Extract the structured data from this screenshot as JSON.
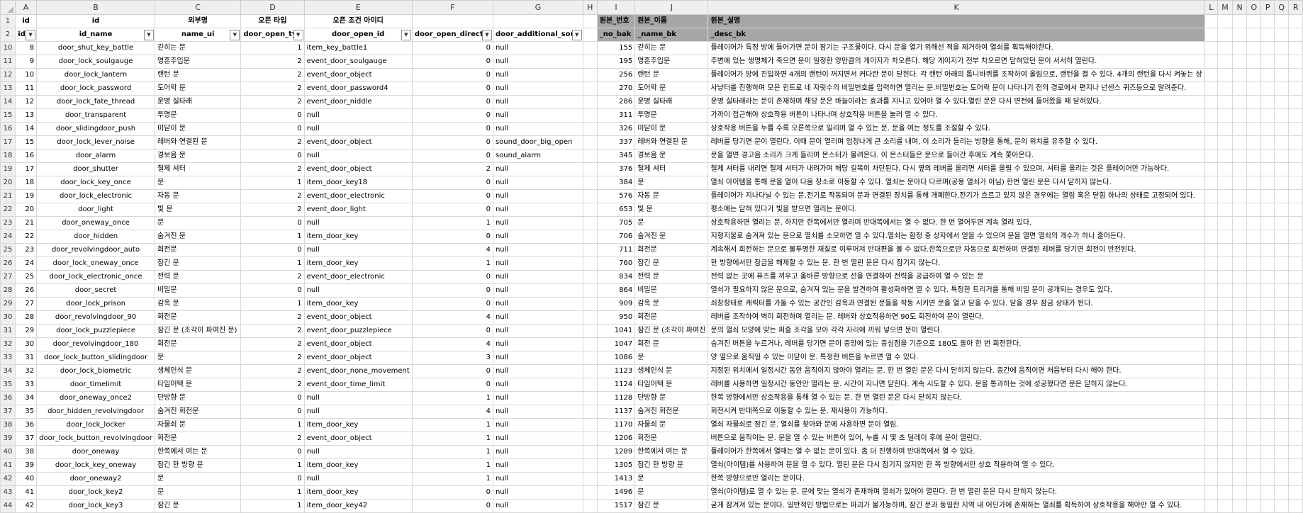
{
  "columns": [
    "A",
    "B",
    "C",
    "D",
    "E",
    "F",
    "G",
    "H",
    "I",
    "J",
    "K",
    "L",
    "M",
    "N",
    "O",
    "P",
    "Q",
    "R"
  ],
  "header1": [
    "id",
    "id",
    "외부명",
    "오픈 타입",
    "오픈 조건 아이디",
    "",
    "",
    "",
    "원본_번호",
    "원본_이름",
    "원본_설명",
    "",
    "",
    "",
    "",
    "",
    "",
    ""
  ],
  "header2": [
    "id_n",
    "id_name",
    "name_ui",
    "door_open_typ",
    "door_open_id",
    "door_open_directio",
    "door_additional_soun",
    "",
    "_no_bak",
    "_name_bk",
    "_desc_bk",
    "",
    "",
    "",
    "",
    "",
    "",
    ""
  ],
  "rows": [
    {
      "n": "10",
      "c": [
        "8",
        "door_shut_key_battle",
        "갇히는 문",
        "1",
        "item_key_battle1",
        "0",
        "null",
        "",
        "155",
        "갇히는 문",
        "플레이어가 특정 방에 들어가면 문이 잠기는 구조물이다. 다시 문을 열기 위해선 적을 제거하여 열쇠를 획득해야한다."
      ]
    },
    {
      "n": "11",
      "c": [
        "9",
        "door_lock_soulgauge",
        "영혼주입문",
        "2",
        "event_door_soulgauge",
        "0",
        "null",
        "",
        "195",
        "영혼주입문",
        "주변에 있는 생명체가 죽으면 문이 일정한 양만큼의 게이지가 차오른다. 해당 게이지가 전부 차오르면 닫혀있던 문이 서서히 열린다."
      ]
    },
    {
      "n": "12",
      "c": [
        "10",
        "door_lock_lantern",
        "랜턴 문",
        "2",
        "event_door_object",
        "0",
        "null",
        "",
        "256",
        "랜턴 문",
        "플레이어가 방에 진입하면 4개의 랜턴이 꺼지면서 커다란 문이 닫힌다. 각 랜턴 아래의 톱니바퀴를 조작하여 올림으로, 랜턴을 켤 수 있다. 4개의 랜턴을 다시 켜놓는 상"
      ]
    },
    {
      "n": "13",
      "c": [
        "11",
        "door_lock_password",
        "도어락 문",
        "2",
        "event_door_password4",
        "0",
        "null",
        "",
        "270",
        "도어락 문",
        "사냥터를 진행하며 모은 힌트로 네 자릿수의 비밀번호를 입력하면 열리는 문.비밀번호는 도어락 문이 나타나기 전의 경로에서 편지나 넌센스 퀴즈등으로 알려준다."
      ]
    },
    {
      "n": "14",
      "c": [
        "12",
        "door_lock_fate_thread",
        "운명 실타래",
        "2",
        "event_door_niddle",
        "0",
        "null",
        "",
        "286",
        "운명 실타래",
        "운명 실타래라는 문이 존재하며 해당 문은 바늘이라는 효과를 지니고 있어야 열 수 있다.열린 문은 다시 면전에 들어왔을 때 닫혀있다."
      ]
    },
    {
      "n": "15",
      "c": [
        "13",
        "door_transparent",
        "투명문",
        "0",
        "null",
        "0",
        "null",
        "",
        "311",
        "투명문",
        "가까이 접근해야 상호작용 버튼이 나타나며 상호작용 버튼을 눌러 열 수 있다."
      ]
    },
    {
      "n": "16",
      "c": [
        "14",
        "door_slidingdoor_push",
        "미닫이 문",
        "0",
        "null",
        "0",
        "null",
        "",
        "326",
        "미닫이 문",
        "상호작용 버튼을 누를 수록 오른쪽으로 밀리며 열 수 있는 문. 문을 여는 정도를 조절할 수 있다."
      ]
    },
    {
      "n": "17",
      "c": [
        "15",
        "door_lock_lever_noise",
        "레버와 연결된 문",
        "2",
        "event_door_object",
        "0",
        "sound_door_big_open",
        "",
        "337",
        "레버와 연결된 문",
        "레버를 당기면 문이 열린다. 이때 문이 열리며 엄청나게 큰 소리를 내며, 이 소리가 들리는 방향을 통해, 문의 위치를 유추할 수 있다."
      ]
    },
    {
      "n": "18",
      "c": [
        "16",
        "door_alarm",
        "경보음 문",
        "0",
        "null",
        "0",
        "sound_alarm",
        "",
        "345",
        "경보음 문",
        "문을 열면 경고음 소리가 크게 들리며 몬스터가 몰려온다. 이 몬스터들은 문으로 들어간 후에도 계속 쫓아온다."
      ]
    },
    {
      "n": "19",
      "c": [
        "17",
        "door_shutter",
        "철제 셔터",
        "2",
        "event_door_object",
        "2",
        "null",
        "",
        "376",
        "철제 셔터",
        "철제 셔터를 내리면 철제 셔터가 내려가며 해당 길목이 차단된다. 다시 옆의 레버를 올리면 셔터를 올릴 수 있으며, 셔터를 올리는 것은 플레이어만 가능하다."
      ]
    },
    {
      "n": "20",
      "c": [
        "18",
        "door_lock_key_once",
        "문",
        "1",
        "item_door_key18",
        "0",
        "null",
        "",
        "384",
        "문",
        "열쇠 아이템을 통해 문을 열어 다음 장소로 이동할 수 있다. 열쇠는 문마다 다르며(공용 열쇠가 아님) 한번 열린 문은 다시 닫히지 않는다."
      ]
    },
    {
      "n": "21",
      "c": [
        "19",
        "door_lock_electronic",
        "자동 문",
        "2",
        "event_door_electronic",
        "0",
        "null",
        "",
        "576",
        "자동 문",
        "플레이어가 지나다닐 수 있는 문.전기로 작동되며 문과 연결된 장치를 통해 개폐한다.전기가 흐르고 있지 않은 경우에는 열림 혹은 닫힘 하나의 상태로 고정되어 있다."
      ]
    },
    {
      "n": "22",
      "c": [
        "20",
        "door_light",
        "빛 문",
        "2",
        "event_door_light",
        "0",
        "null",
        "",
        "653",
        "빛 문",
        "평소에는 닫혀 있다가 빛을 받으면 열리는 문이다."
      ]
    },
    {
      "n": "23",
      "c": [
        "21",
        "door_oneway_once",
        "문",
        "0",
        "null",
        "1",
        "null",
        "",
        "705",
        "문",
        "상호작용하면 열리는 문. 하지만 한쪽에서만 열리며 반대쪽에서는 열 수 없다. 한 번 열어두면 계속 열려 있다."
      ]
    },
    {
      "n": "24",
      "c": [
        "22",
        "door_hidden",
        "숨겨진 문",
        "1",
        "item_door_key",
        "0",
        "null",
        "",
        "706",
        "숨겨진 문",
        "지형지물로 숨겨져 있는 문으로 열쇠를 소모하면 열 수 있다.열쇠는 함정 중 상자에서 얻을 수 있으며 문을 열면 열쇠의 개수가 하나 줄어든다."
      ]
    },
    {
      "n": "25",
      "c": [
        "23",
        "door_revolvingdoor_auto",
        "회전문",
        "0",
        "null",
        "4",
        "null",
        "",
        "711",
        "회전문",
        "계속해서 회전하는 문으로 불투명한 재질로 이루어져 반대편을 볼 수 없다.한쪽으로만 자동으로 회전하며 연결된 레버를 당기면 회전이 반전된다."
      ]
    },
    {
      "n": "26",
      "c": [
        "24",
        "door_lock_oneway_once",
        "잠긴 문",
        "1",
        "item_door_key",
        "1",
        "null",
        "",
        "760",
        "잠긴 문",
        "한 방향에서만 잠금을 해제할 수 있는 문. 한 번 열린 문은 다시 잠기지 않는다."
      ]
    },
    {
      "n": "27",
      "c": [
        "25",
        "door_lock_electronic_once",
        "전력 문",
        "2",
        "event_door_electronic",
        "0",
        "null",
        "",
        "834",
        "전력 문",
        "전력 없는 곳에 퓨즈를 끼우고 올바른 방향으로 선을 연결하여 전력을 공급하여 열 수 있는 문"
      ]
    },
    {
      "n": "28",
      "c": [
        "26",
        "door_secret",
        "비밀문",
        "0",
        "null",
        "0",
        "null",
        "",
        "864",
        "비밀문",
        "열쇠가 필요하지 않은 문으로, 숨겨져 있는 문을 발견하여 활성화하면 열 수 있다. 특정한 트리거를 통해 비밀 문이 공개되는 경우도 있다."
      ]
    },
    {
      "n": "29",
      "c": [
        "27",
        "door_lock_prison",
        "감옥 문",
        "1",
        "item_door_key",
        "0",
        "null",
        "",
        "909",
        "감옥 문",
        "쇠창창태로 캐릭터를 가둘 수 있는 공간인 감옥과 연결된 문들을 작동 시키면 문을 열고 닫을 수 있다. 닫을 경우 잠금 상태가 된다."
      ]
    },
    {
      "n": "30",
      "c": [
        "28",
        "door_revolvingdoor_90",
        "회전문",
        "2",
        "event_door_object",
        "4",
        "null",
        "",
        "950",
        "회전문",
        "레버를 조작하여 벽이 회전하며 열리는 문. 레버와 상호작용하면 90도 회전하여 문이 열린다."
      ]
    },
    {
      "n": "31",
      "c": [
        "29",
        "door_lock_puzzlepiece",
        "잠긴 문 (조각이 파여진 문)",
        "2",
        "event_door_puzzlepiece",
        "0",
        "null",
        "",
        "1041",
        "잠긴 문 (조각이 파여진",
        "문의 열쇠 모양에 맞는 퍼즐 조각을 모아 각각 자리에 끼워 넣으면 문이 열린다."
      ]
    },
    {
      "n": "32",
      "c": [
        "30",
        "door_revolvingdoor_180",
        "회전문",
        "2",
        "event_door_object",
        "4",
        "null",
        "",
        "1047",
        "회전 문",
        "숨겨진 버튼을 누르거나, 레버를 당기면 문이 중앙에 있는 중심점을 기준으로 180도 돌아 한 번 회전한다."
      ]
    },
    {
      "n": "33",
      "c": [
        "31",
        "door_lock_button_slidingdoor",
        "문",
        "2",
        "event_door_object",
        "3",
        "null",
        "",
        "1086",
        "문",
        "양 옆으로 움직일 수 있는 미닫이 문. 특정한 버튼을 누르면 열 수 있다."
      ]
    },
    {
      "n": "34",
      "c": [
        "32",
        "door_lock_biometric",
        "생체인식 문",
        "2",
        "event_door_none_movement",
        "0",
        "null",
        "",
        "1123",
        "생체인식 문",
        "지정된 위치에서 일정시간 동안 움직이지 않아야 열리는 문. 한 번 열린 문은 다시 닫히지 않는다. 중간에 움직이면 처음부터 다시 해야 한다."
      ]
    },
    {
      "n": "35",
      "c": [
        "33",
        "door_timelimit",
        "타임어택 문",
        "2",
        "event_door_time_limit",
        "0",
        "null",
        "",
        "1124",
        "타임어택 문",
        "레버를 사용하면 일정시간 동안만 열리는 문. 시간이 지나면 닫힌다. 계속 시도할 수 있다. 문을 통과하는 것에 성공했다면 문은 닫히지 않는다."
      ]
    },
    {
      "n": "36",
      "c": [
        "34",
        "door_oneway_once2",
        "단방향 문",
        "0",
        "null",
        "1",
        "null",
        "",
        "1128",
        "단방향 문",
        "한쪽 방향에서만 상호작용을 통해 열 수 있는 문. 한 번 열린 문은 다시 닫히지 않는다."
      ]
    },
    {
      "n": "37",
      "c": [
        "35",
        "door_hidden_revolvingdoor",
        "숨겨진 회전문",
        "0",
        "null",
        "4",
        "null",
        "",
        "1137",
        "숨겨진 회전문",
        "회전시켜 반대쪽으로 이동할 수 있는 문. 재사용이 가능하다."
      ]
    },
    {
      "n": "38",
      "c": [
        "36",
        "door_lock_locker",
        "자물쇠 문",
        "1",
        "item_door_key",
        "1",
        "null",
        "",
        "1170",
        "자물쇠 문",
        "열쇠 자물쇠로 잠긴 문. 열쇠를 찾아와 문에 사용하면 문이 열림."
      ]
    },
    {
      "n": "39",
      "c": [
        "37",
        "door_lock_button_revolvingdoor",
        "회전문",
        "2",
        "event_door_object",
        "1",
        "null",
        "",
        "1206",
        "회전문",
        "버튼으로 움직이는 문. 문을 열 수 있는 버튼이 있어, 누를 시 몇 초 딜레이 후에 문이 열린다."
      ]
    },
    {
      "n": "40",
      "c": [
        "38",
        "door_oneway",
        "한쪽에서 여는 문",
        "0",
        "null",
        "1",
        "null",
        "",
        "1289",
        "한쪽에서 여는 문",
        "플레이어가 한쪽에서 열때는 열 수 없는 문이 있다. 좀 더 진행하여 반대쪽에서 열 수 있다."
      ]
    },
    {
      "n": "41",
      "c": [
        "39",
        "door_lock_key_oneway",
        "잠긴 한 방향 문",
        "1",
        "item_door_key",
        "1",
        "null",
        "",
        "1305",
        "잠긴 한 방향 문",
        "열쇠(아이템)를 사용하여 문을 열 수 있다. 열린 문은 다시 잠기지 않지만 한 쪽 방향에서만 상호 작용하여 열 수 있다."
      ]
    },
    {
      "n": "42",
      "c": [
        "40",
        "door_oneway2",
        "문",
        "0",
        "null",
        "1",
        "null",
        "",
        "1413",
        "문",
        "한쪽 방향으로만 열리는 문이다."
      ]
    },
    {
      "n": "43",
      "c": [
        "41",
        "door_lock_key2",
        "문",
        "1",
        "item_door_key",
        "0",
        "null",
        "",
        "1496",
        "문",
        "열쇠(아이템)로 열 수 있는 문. 문에 맞는 열쇠가 존재하며 열쇠가 있어야 열린다. 한 번 열린 문은 다시 닫히지 않는다."
      ]
    },
    {
      "n": "44",
      "c": [
        "42",
        "door_lock_key3",
        "잠긴 문",
        "1",
        "item_door_key42",
        "0",
        "null",
        "",
        "1517",
        "잠긴 문",
        "굳게 잠겨져 있는 문이다. 일반적인 방법으로는 파괴가 불가능하며, 잠긴 문과 동일한 지역 내 어딘가에 존재하는 열쇠를 획득하여 상호작용을 해야만 열 수 있다."
      ]
    }
  ]
}
